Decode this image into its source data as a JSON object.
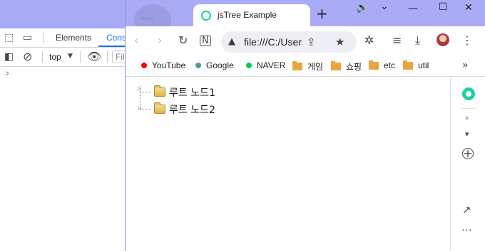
{
  "devtools": {
    "tabs": [
      "Elements",
      "Cons"
    ],
    "context": "top",
    "filter_placeholder": "Fil",
    "prompt": "›",
    "icons": [
      "inspect-element-icon",
      "device-toolbar-icon",
      "sidebar-toggle-icon",
      "clear-console-icon",
      "eye-icon"
    ]
  },
  "chrome": {
    "tab_title": "jsTree Example",
    "new_tab": "+",
    "window_controls": {
      "sound": "🔊",
      "dropdown": "⌄",
      "minimize": "—",
      "maximize": "☐",
      "close": "✕"
    },
    "url": "file:///C:/Users",
    "bookmarks": [
      {
        "label": "YouTube",
        "type": "dot",
        "color": "#ff0000"
      },
      {
        "label": "Google",
        "type": "dot",
        "color": "#4a9e9e"
      },
      {
        "label": "NAVER",
        "type": "dot",
        "color": "#03c75a"
      },
      {
        "label": "게임",
        "type": "folder"
      },
      {
        "label": "쇼핑",
        "type": "folder"
      },
      {
        "label": "etc",
        "type": "folder"
      },
      {
        "label": "util",
        "type": "folder"
      }
    ],
    "bookmarks_more": "»",
    "tree": {
      "nodes": [
        {
          "label": "루트 노드1"
        },
        {
          "label": "루트 노드2"
        }
      ]
    },
    "side_panel": {
      "add": "+",
      "more": "⋯"
    }
  },
  "colors": {
    "titlebar": "#a9abf7",
    "accent": "#1a73e8",
    "app_green": "#1bd1a1",
    "folder": "#e7a73a"
  }
}
